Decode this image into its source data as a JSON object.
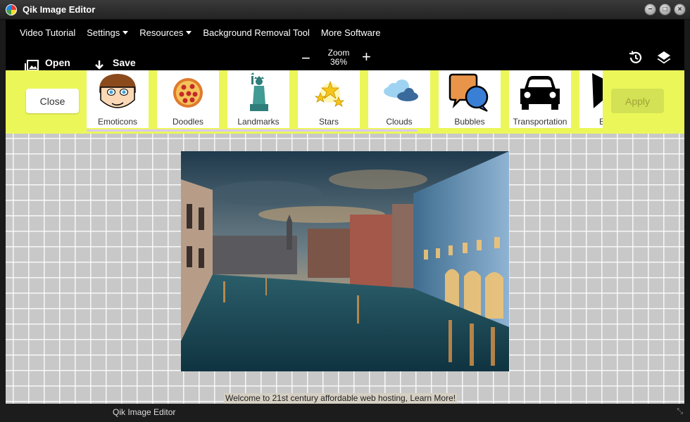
{
  "window": {
    "title": "Qik Image Editor"
  },
  "menu": {
    "items": [
      {
        "label": "Video Tutorial",
        "dropdown": false
      },
      {
        "label": "Settings",
        "dropdown": true
      },
      {
        "label": "Resources",
        "dropdown": true
      },
      {
        "label": "Background Removal Tool",
        "dropdown": false
      },
      {
        "label": "More Software",
        "dropdown": false
      }
    ]
  },
  "toolbar": {
    "open_label": "Open",
    "save_label": "Save",
    "zoom_label": "Zoom",
    "zoom_value": "36%",
    "zoom_out": "−",
    "zoom_in": "+"
  },
  "panel": {
    "close_label": "Close",
    "apply_label": "Apply",
    "categories": [
      {
        "label": "Emoticons",
        "icon": "emoticon-face-icon"
      },
      {
        "label": "Doodles",
        "icon": "pizza-icon"
      },
      {
        "label": "Landmarks",
        "icon": "statue-of-liberty-icon"
      },
      {
        "label": "Stars",
        "icon": "stars-icon"
      },
      {
        "label": "Clouds",
        "icon": "clouds-icon"
      },
      {
        "label": "Bubbles",
        "icon": "speech-bubbles-icon"
      },
      {
        "label": "Transportation",
        "icon": "car-icon"
      },
      {
        "label": "B",
        "icon": "partial-icon"
      }
    ]
  },
  "canvas": {
    "banner_text": "Welcome to 21st century affordable web hosting, ",
    "banner_link": "Learn More!"
  },
  "status": {
    "text": "Qik Image Editor",
    "grip": "⤡"
  },
  "colors": {
    "panel_bg": "#ebf759",
    "apply_bg": "#d3e154",
    "bar_bg": "#000000"
  }
}
